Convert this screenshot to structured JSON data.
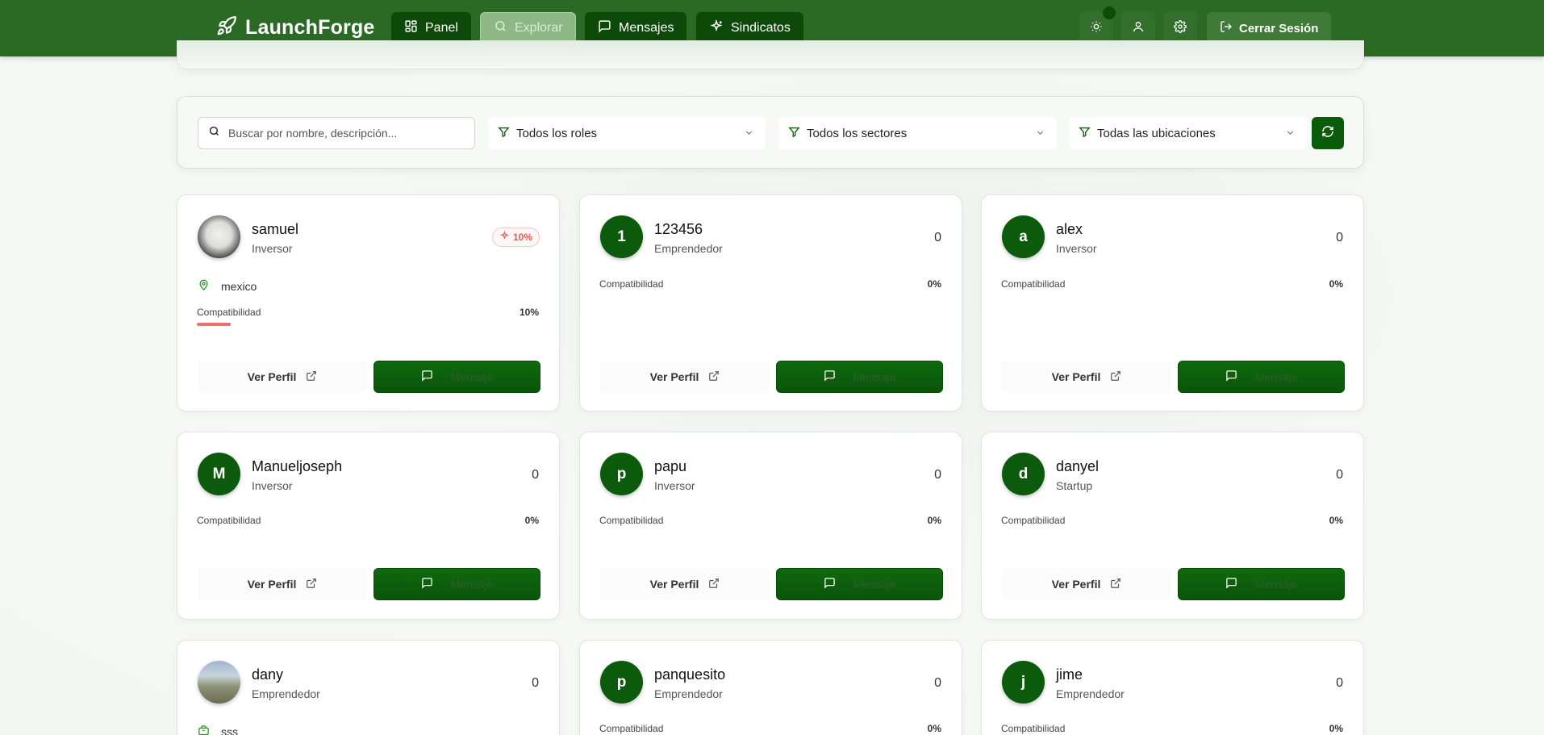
{
  "app": {
    "brand": "LaunchForge",
    "nav": [
      {
        "label": "Panel",
        "icon": "grid-icon"
      },
      {
        "label": "Explorar",
        "icon": "search-icon",
        "active": true
      },
      {
        "label": "Mensajes",
        "icon": "message-icon"
      },
      {
        "label": "Sindicatos",
        "icon": "sparkles-icon"
      }
    ],
    "logout_label": "Cerrar Sesión"
  },
  "filters": {
    "search_placeholder": "Buscar por nombre, descripción...",
    "role": "Todos los roles",
    "sector": "Todos los sectores",
    "location": "Todas las ubicaciones"
  },
  "labels": {
    "compat": "Compatibilidad",
    "view_profile": "Ver Perfil",
    "message": "Mensaje"
  },
  "cards": [
    {
      "name": "samuel",
      "role": "Inversor",
      "initial": "",
      "score": "10%",
      "location": "mexico",
      "compat_pct": "10%",
      "compat_value": 10
    },
    {
      "name": "123456",
      "role": "Emprendedor",
      "initial": "1",
      "score": "0",
      "compat_pct": "0%",
      "compat_value": 0
    },
    {
      "name": "alex",
      "role": "Inversor",
      "initial": "a",
      "score": "0",
      "compat_pct": "0%",
      "compat_value": 0
    },
    {
      "name": "Manueljoseph",
      "role": "Inversor",
      "initial": "M",
      "score": "0",
      "compat_pct": "0%",
      "compat_value": 0
    },
    {
      "name": "papu",
      "role": "Inversor",
      "initial": "p",
      "score": "0",
      "compat_pct": "0%",
      "compat_value": 0
    },
    {
      "name": "danyel",
      "role": "Startup",
      "initial": "d",
      "score": "0",
      "compat_pct": "0%",
      "compat_value": 0
    },
    {
      "name": "dany",
      "role": "Emprendedor",
      "initial": "",
      "score": "0",
      "sector": "sss"
    },
    {
      "name": "panquesito",
      "role": "Emprendedor",
      "initial": "p",
      "score": "0",
      "compat_pct": "0%",
      "compat_value": 0
    },
    {
      "name": "jime",
      "role": "Emprendedor",
      "initial": "j",
      "score": "0",
      "compat_pct": "0%",
      "compat_value": 0
    }
  ],
  "colors": {
    "navbar": "#2b6a24",
    "primary": "#0c5a0b",
    "badge_red": "#e35a5a"
  }
}
